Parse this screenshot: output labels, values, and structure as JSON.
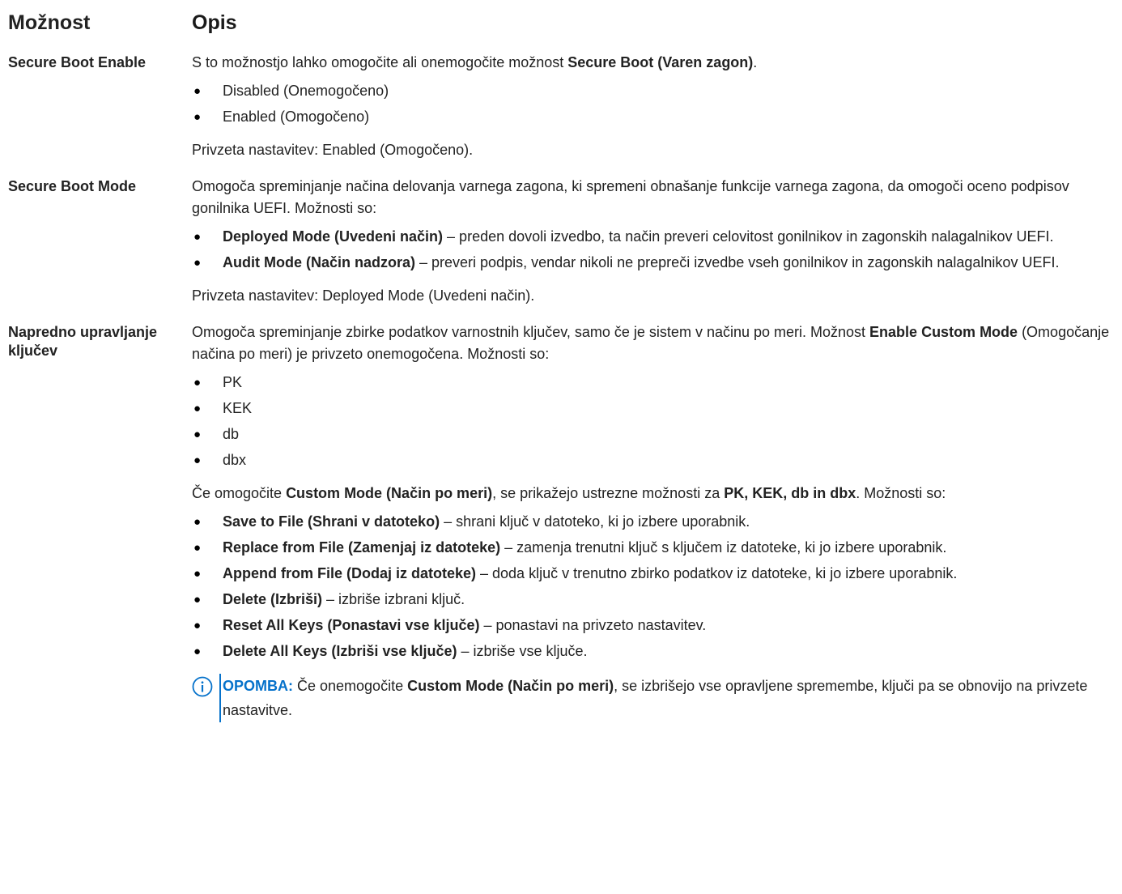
{
  "header": {
    "col1": "Možnost",
    "col2": "Opis"
  },
  "rows": [
    {
      "option": "Secure Boot Enable",
      "intro_pre": "S to možnostjo lahko omogočite ali onemogočite možnost ",
      "intro_bold": "Secure Boot (Varen zagon)",
      "intro_post": ".",
      "items": [
        "Disabled (Onemogočeno)",
        "Enabled (Omogočeno)"
      ],
      "default": "Privzeta nastavitev: Enabled (Omogočeno)."
    },
    {
      "option": "Secure Boot Mode",
      "intro": "Omogoča spreminjanje načina delovanja varnega zagona, ki spremeni obnašanje funkcije varnega zagona, da omogoči oceno podpisov gonilnika UEFI. Možnosti so:",
      "items": [
        {
          "bold": "Deployed Mode (Uvedeni način)",
          "text": " – preden dovoli izvedbo, ta način preveri celovitost gonilnikov in zagonskih nalagalnikov UEFI."
        },
        {
          "bold": "Audit Mode (Način nadzora)",
          "text": " – preveri podpis, vendar nikoli ne prepreči izvedbe vseh gonilnikov in zagonskih nalagalnikov UEFI."
        }
      ],
      "default": "Privzeta nastavitev: Deployed Mode (Uvedeni način)."
    },
    {
      "option": "Napredno upravljanje ključev",
      "intro_pre": "Omogoča spreminjanje zbirke podatkov varnostnih ključev, samo če je sistem v načinu po meri. Možnost ",
      "intro_bold": "Enable Custom Mode",
      "intro_post": " (Omogočanje načina po meri) je privzeto onemogočena. Možnosti so:",
      "keys": [
        "PK",
        "KEK",
        "db",
        "dbx"
      ],
      "custom_pre": "Če omogočite ",
      "custom_bold1": "Custom Mode (Način po meri)",
      "custom_mid": ", se prikažejo ustrezne možnosti za ",
      "custom_bold2": "PK, KEK, db in dbx",
      "custom_post": ". Možnosti so:",
      "actions": [
        {
          "bold": "Save to File (Shrani v datoteko)",
          "text": " – shrani ključ v datoteko, ki jo izbere uporabnik."
        },
        {
          "bold": "Replace from File (Zamenjaj iz datoteke)",
          "text": " – zamenja trenutni ključ s ključem iz datoteke, ki jo izbere uporabnik."
        },
        {
          "bold": "Append from File (Dodaj iz datoteke)",
          "text": " – doda ključ v trenutno zbirko podatkov iz datoteke, ki jo izbere uporabnik."
        },
        {
          "bold": "Delete (Izbriši)",
          "text": " – izbriše izbrani ključ."
        },
        {
          "bold": "Reset All Keys (Ponastavi vse ključe)",
          "text": " – ponastavi na privzeto nastavitev."
        },
        {
          "bold": "Delete All Keys (Izbriši vse ključe)",
          "text": " – izbriše vse ključe."
        }
      ],
      "note": {
        "label": "OPOMBA:",
        "pre": " Če onemogočite ",
        "bold": "Custom Mode (Način po meri)",
        "post": ", se izbrišejo vse opravljene spremembe, ključi pa se obnovijo na privzete nastavitve."
      }
    }
  ],
  "icons": {
    "bullet": "●",
    "note_icon": "info-circle-icon",
    "accent": "#0672cb"
  }
}
